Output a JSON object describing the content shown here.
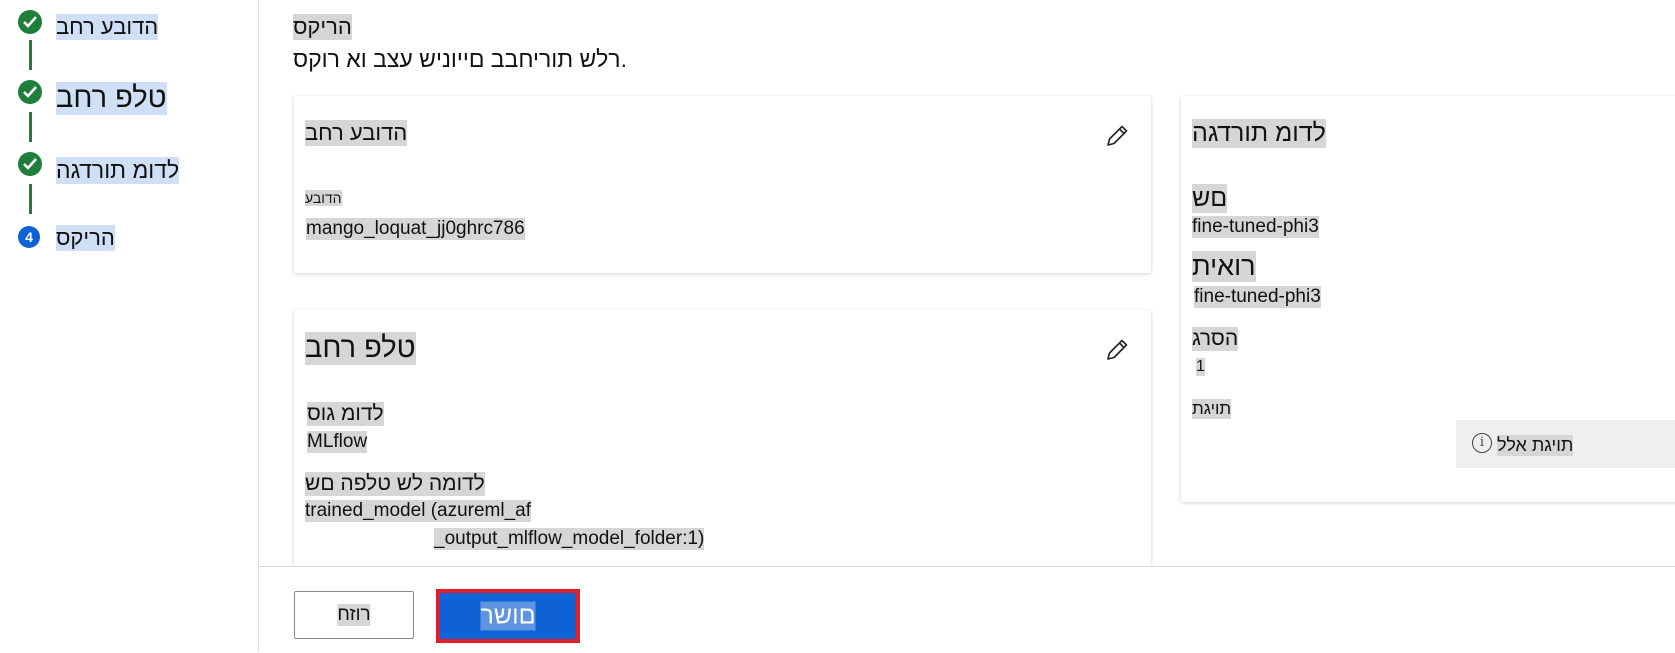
{
  "stepper": {
    "steps": [
      {
        "label": "הדובע רחב",
        "status": "complete"
      },
      {
        "label": "טלפ רחב",
        "status": "complete"
      },
      {
        "label": "לדומ תורדגה",
        "status": "complete"
      },
      {
        "label": "הריקס",
        "status": "current",
        "number": "4"
      }
    ]
  },
  "review": {
    "heading": "הריקס",
    "description": "רלש תוריחבב םייוניש עצב וא רוקס."
  },
  "job_card": {
    "title": "הדובע רחב",
    "job_label": "הדובע",
    "job_value": "mango_loquat_jj0ghrc786"
  },
  "output_card": {
    "title": "טלפ רחב",
    "model_type_label": "לדומ גוס",
    "model_type_value": "MLflow",
    "artifact_label": "לדומה לש טלפה םש",
    "artifact_value_line1": "trained_model (azureml_af",
    "artifact_value_line2": "_output_mlflow_model_folder:1)"
  },
  "settings_card": {
    "title": "לדומ תורדגה",
    "name_label": "םש",
    "name_value": "fine-tuned-phi3",
    "description_label": "רואית",
    "description_value": "fine-tuned-phi3",
    "version_label": "הסרג",
    "version_value": "1",
    "tags_label": "תויגת",
    "tags_empty": "תויגת אלל"
  },
  "footer": {
    "back_label": "רוזח",
    "create_label": "םושר"
  },
  "colors": {
    "complete": "#1e7f3a",
    "primary": "#0f62d6",
    "highlight_border": "#e01f2e"
  },
  "icons": [
    "check-icon",
    "pencil-icon",
    "info-icon"
  ]
}
